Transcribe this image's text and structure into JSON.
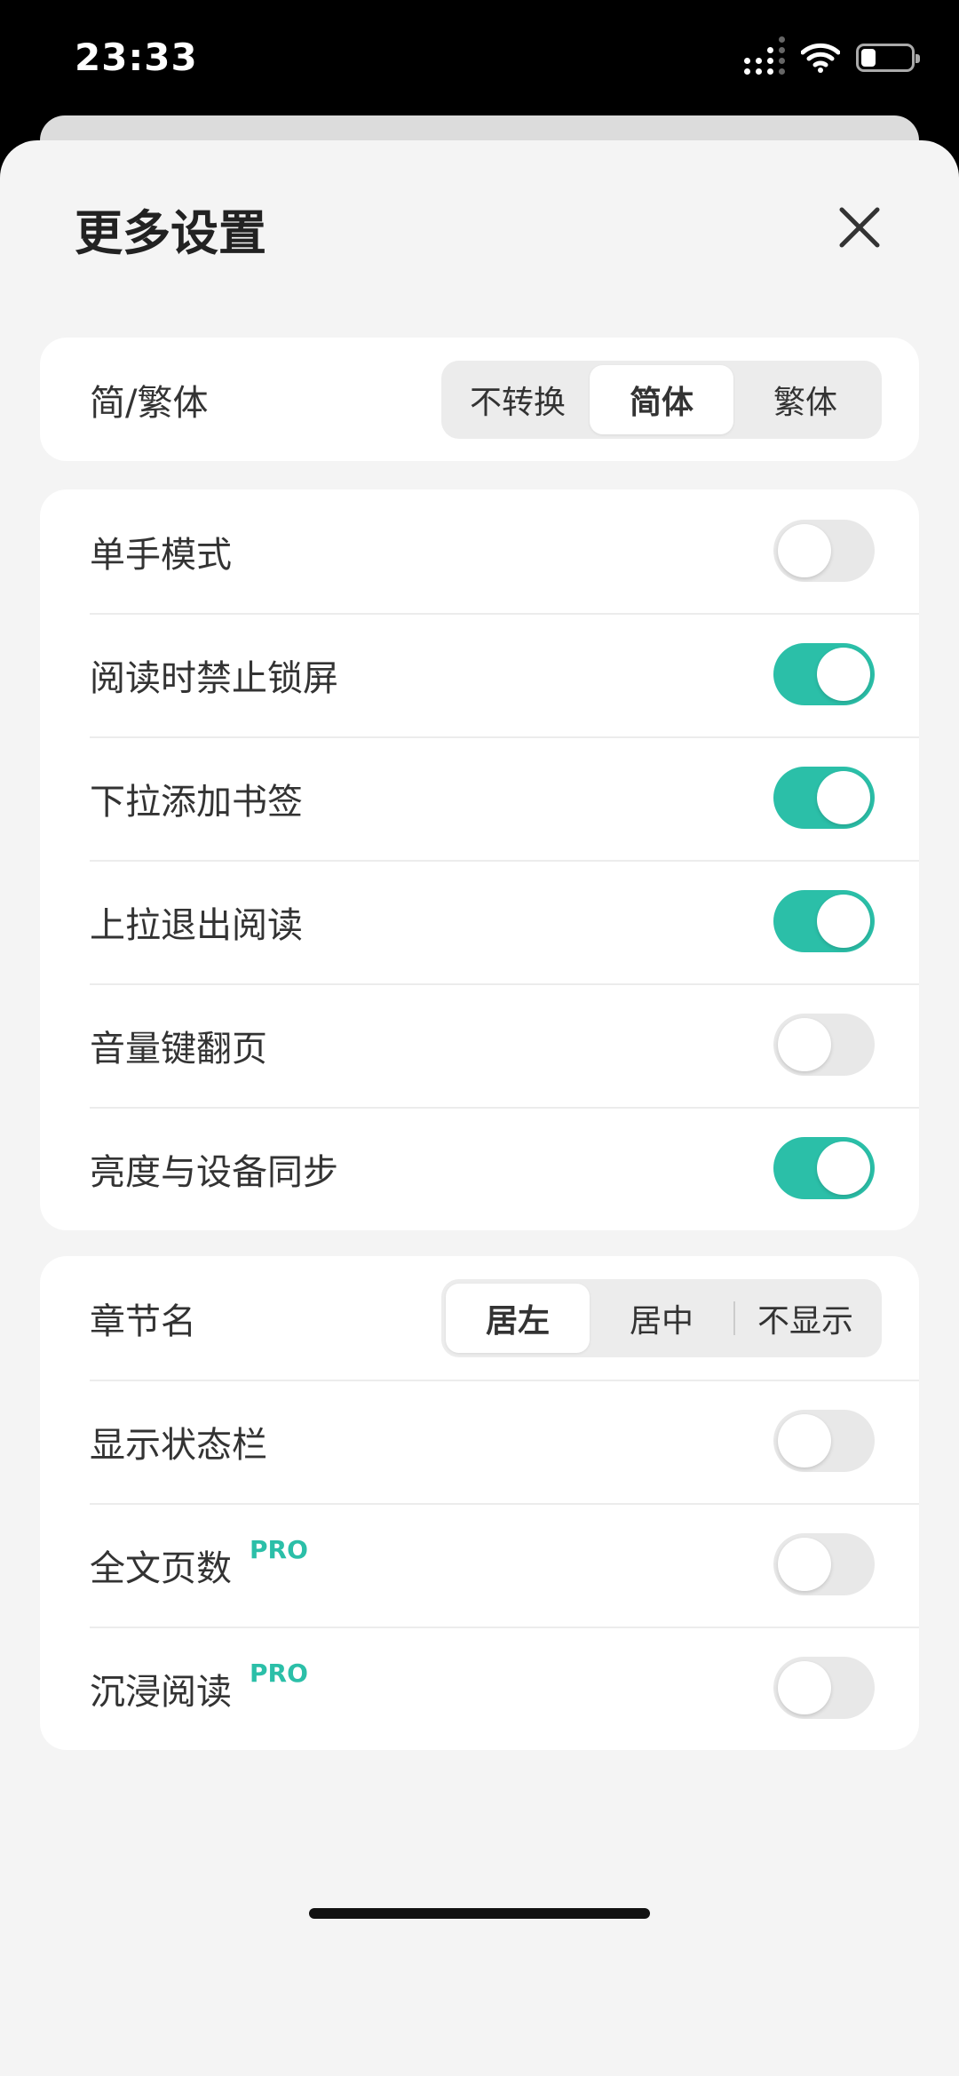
{
  "status_bar": {
    "time": "23:33",
    "battery_level": 0.3
  },
  "sheet": {
    "title": "更多设置"
  },
  "script_setting": {
    "label": "简/繁体",
    "options": [
      "不转换",
      "简体",
      "繁体"
    ],
    "selected": "简体"
  },
  "toggles_group1": [
    {
      "label": "单手模式",
      "on": false
    },
    {
      "label": "阅读时禁止锁屏",
      "on": true
    },
    {
      "label": "下拉添加书签",
      "on": true
    },
    {
      "label": "上拉退出阅读",
      "on": true
    },
    {
      "label": "音量键翻页",
      "on": false
    },
    {
      "label": "亮度与设备同步",
      "on": true
    }
  ],
  "chapter_name": {
    "label": "章节名",
    "options": [
      "居左",
      "居中",
      "不显示"
    ],
    "selected": "居左"
  },
  "toggles_group2": [
    {
      "label": "显示状态栏",
      "on": false
    },
    {
      "label": "全文页数",
      "badge": "PRO",
      "on": false
    },
    {
      "label": "沉浸阅读",
      "badge": "PRO",
      "on": false
    }
  ],
  "colors": {
    "accent": "#2bbfa8",
    "background": "#f4f4f4"
  }
}
